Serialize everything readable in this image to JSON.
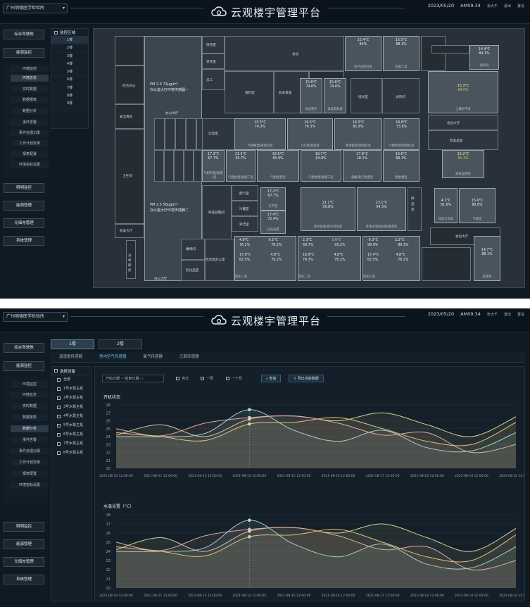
{
  "location": "广州明德医学检验所",
  "app_title": "云观楼宇管理平台",
  "date": "2023/05/20",
  "time": "AM09:34",
  "user": "张大千",
  "logout": "退出",
  "settings": "置设",
  "sidebar_1": {
    "top_items": [
      "综合驾驶舱",
      "能源监控"
    ],
    "sub_items": [
      "环境监控",
      "环境总览",
      "实时数据",
      "数据报表",
      "数据分析",
      "事件告警",
      "事件处理记录",
      "工作计划安排",
      "报表配置",
      "环境指标设置"
    ],
    "active_sub": "环境总览",
    "bottom_items": [
      "照明监控",
      "能源管理",
      "光储充管理",
      "系统管理"
    ]
  },
  "floor_panel": {
    "title": "监控区域",
    "floors": [
      "1楼",
      "2楼",
      "3楼",
      "4楼",
      "5楼",
      "6楼",
      "7楼",
      "8楼",
      "9楼"
    ]
  },
  "plan": {
    "rooms": [
      "接待室",
      "会议",
      "综合办公",
      "安全库房",
      "更衣室",
      "员工",
      "消控",
      "检验室",
      "办公大厅",
      "卫生间",
      "资料室",
      "标本接收",
      "培训室",
      "冷藏室",
      "试剂间",
      "茶水间",
      "配气室",
      "清洁间",
      "会议",
      "检测室"
    ],
    "extra_rooms": {
      "stairs_a": "楼梯间",
      "stairs_b": "楼梯间",
      "corridor": "走廊",
      "lab": "实验室",
      "pantry": "茶水间",
      "office2": "办公大厅"
    },
    "office_sensors": [
      {
        "pm": "PM 2.5  72μg/m³",
        "name": "办公室大厅环境传感器一",
        "sub": "办公大厅"
      },
      {
        "pm": "PM 2.5  50μg/m³",
        "name": "办公室大厅环境传感器二",
        "sub": "办公大厅"
      }
    ],
    "sensors": [
      {
        "t": "15.4°C",
        "h": "84%",
        "n": "农产品检验室"
      },
      {
        "t": "15.5°C",
        "h": "88.1%",
        "n": "标准二室"
      },
      {
        "t": "14.4°C",
        "h": "84.1%",
        "n": "试剂间"
      },
      {
        "t": "15.8°C",
        "h": "74.6%",
        "n": "样品暂存"
      },
      {
        "t": "15.8°C",
        "h": "74.6%",
        "n": "样品前处理"
      },
      {
        "t": "15.3°C",
        "h": "84.0%",
        "n": "土壤风干室"
      },
      {
        "t": "15.5°C",
        "h": "74.3%",
        "n": "气相色谱/质谱仪室"
      },
      {
        "t": "16.5°C",
        "h": "74.3%",
        "n": "工作站/检验室"
      },
      {
        "t": "19.3°C",
        "h": "81.8%",
        "n": "色谱质谱/质谱仪室"
      },
      {
        "t": "16.8°C",
        "h": "73.6%",
        "n": "气相色谱/质谱仪室"
      },
      {
        "t": "17.3°C",
        "h": "67.7%",
        "n": "气相色谱/质谱一室"
      },
      {
        "t": "21.3°C",
        "h": "56.7%",
        "n": "气相色谱/质谱二室"
      },
      {
        "t": "18.6°C",
        "h": "65.9%",
        "n": "气相色谱室"
      },
      {
        "t": "18.7°C",
        "h": "64.8%",
        "n": "气相色谱/质谱三室"
      },
      {
        "t": "27.8°C",
        "h": "28.1%",
        "n": "液相/离子色谱室"
      },
      {
        "t": "16.6°C",
        "h": "68.3%",
        "n": "微生物室"
      },
      {
        "t": "15.2°C",
        "h": "81.3%",
        "n": "取样品测室"
      },
      {
        "t": "17.2°C",
        "h": "67.7%",
        "n": "天平室"
      },
      {
        "t": "17.4°C",
        "h": "72.4%",
        "n": "分光光度"
      },
      {
        "t": "21.1°C",
        "h": "59.8%",
        "n": "原子吸收/原子荧光室"
      },
      {
        "t": "23.1°C",
        "h": "54.3%",
        "n": "等离子发射光谱/质谱室"
      },
      {
        "t": "4.1°C",
        "h": "81.6%",
        "n": "样品冷冻间"
      },
      {
        "t": "15.4°C",
        "h": "80.8%",
        "n": "气瓶室"
      },
      {
        "t": "14.7°C",
        "h": "88.1%",
        "n": "危废室"
      }
    ],
    "cold_rooms": [
      {
        "n": "理化一室",
        "cells": [
          "4.8°C",
          "76.2%",
          "9.1°C",
          "78.2%",
          "17.6°C",
          "62.5%",
          "4.8°C",
          "76.2%"
        ]
      },
      {
        "n": "理化二室",
        "cells": [
          "2.3°C",
          "69.7%",
          "3.6°C",
          "93.2%",
          "16.9°C",
          "74.3%",
          "4.8°C",
          "76.2%"
        ]
      },
      {
        "n": "理化三室",
        "cells": [
          "-0.3°C",
          "99.9%",
          "2.2°C",
          "89.1%",
          "17.4°C",
          "62.5%",
          "4.8°C",
          "76.2%"
        ]
      }
    ],
    "misc_labels": [
      "配气室",
      "清洁室",
      "标准大厅",
      "危化品室",
      "综合类办公室",
      "储藏室",
      "冷藏室",
      "分析库房",
      "样品室",
      "会议大厅",
      "标准品室",
      "样品处理间",
      "接样区域"
    ]
  },
  "sidebar_2": {
    "top_items": [
      "综合驾驶舱",
      "能源监控"
    ],
    "sub_items": [
      "环境监控",
      "环境总览",
      "实时数据",
      "数据报表",
      "数据分析",
      "事件告警",
      "事件处理记录",
      "工作计划安排",
      "报表配置",
      "环境指标设置"
    ],
    "active_sub": "数据分析",
    "bottom_items": [
      "照明监控",
      "能源管理",
      "光储充管理",
      "系统管理"
    ]
  },
  "floor_tabs": [
    "1楼",
    "2楼"
  ],
  "sub_tabs": [
    "温湿度传感器",
    "室内空气传感器",
    "氧气传感器",
    "乙醇传感器"
  ],
  "active_sub_tab": "室内空气传感器",
  "device_panel": {
    "title": "选择设备",
    "devices": [
      "全部",
      "1号水泵主机",
      "2号水泵主机",
      "3号水泵主机",
      "4号水泵主机",
      "5号水泵主机",
      "6号水泵主机",
      "7号水泵主机",
      "8号水泵主机"
    ]
  },
  "filters": {
    "date_start": "开始日期",
    "date_sep": "~",
    "date_end": "结束日期",
    "r1": "当日",
    "r2": "一周",
    "r3": "一个月",
    "query": "查询",
    "export": "导出当前数据"
  },
  "chart_data": [
    {
      "type": "line",
      "title": "开机状态",
      "x": [
        "2021-08-10 12:00:00",
        "2021-08-11 12:00:00",
        "2021-08-13 12:00:00",
        "2021-08-14 12:00:00",
        "2021-08-15 12:00:00",
        "2021-08-16 12:00:00",
        "2021-08-17 12:00:00",
        "2021-08-18 12:00:00",
        "2021-08-19 12:00:00",
        "2021-08-20 12:00:00"
      ],
      "ylim": [
        20,
        28
      ],
      "yticks": [
        20,
        21,
        22,
        23,
        24,
        25,
        26,
        27,
        28
      ],
      "series": [
        {
          "color": "#d0cf8e",
          "values": [
            24.2,
            25.5,
            24.0,
            26.2,
            26.6,
            26.0,
            27.0,
            25.5,
            24.0,
            26.5
          ]
        },
        {
          "color": "#9fd0d6",
          "values": [
            24.0,
            24.0,
            24.4,
            27.4,
            24.8,
            23.4,
            24.8,
            22.6,
            22.2,
            24.5
          ]
        },
        {
          "color": "#e3a9a1",
          "values": [
            25.0,
            24.1,
            25.7,
            26.4,
            26.6,
            25.7,
            24.2,
            24.5,
            22.0,
            23.0
          ]
        },
        {
          "color": "#e3c07a",
          "values": [
            24.5,
            24.0,
            23.5,
            25.6,
            25.8,
            26.4,
            25.0,
            23.4,
            23.0,
            25.8
          ]
        }
      ]
    },
    {
      "type": "line",
      "title": "水温设置（°C）",
      "x": [
        "2021-08-10 12:00:00",
        "2021-08-11 12:00:00",
        "2021-08-13 12:00:00",
        "2021-08-14 12:00:00",
        "2021-08-15 12:00:00",
        "2021-08-16 12:00:00",
        "2021-08-17 12:00:00",
        "2021-08-18 12:00:00",
        "2021-08-19 12:00:00",
        "2021-08-20 12:00:00"
      ],
      "ylim": [
        20,
        28
      ],
      "yticks": [
        20,
        21,
        22,
        23,
        24,
        25,
        26,
        27,
        28
      ],
      "series": [
        {
          "color": "#d0cf8e",
          "values": [
            24.2,
            25.5,
            24.0,
            26.2,
            26.6,
            26.0,
            27.0,
            25.5,
            24.0,
            26.5
          ]
        },
        {
          "color": "#9fd0d6",
          "values": [
            24.0,
            24.0,
            24.4,
            27.4,
            24.8,
            23.4,
            24.8,
            22.6,
            22.2,
            24.5
          ]
        },
        {
          "color": "#e3a9a1",
          "values": [
            25.0,
            24.1,
            25.7,
            26.4,
            26.6,
            25.7,
            24.2,
            24.5,
            22.0,
            23.0
          ]
        },
        {
          "color": "#e3c07a",
          "values": [
            24.5,
            24.0,
            23.5,
            25.6,
            25.8,
            26.4,
            25.0,
            23.4,
            23.0,
            25.8
          ]
        }
      ]
    }
  ]
}
